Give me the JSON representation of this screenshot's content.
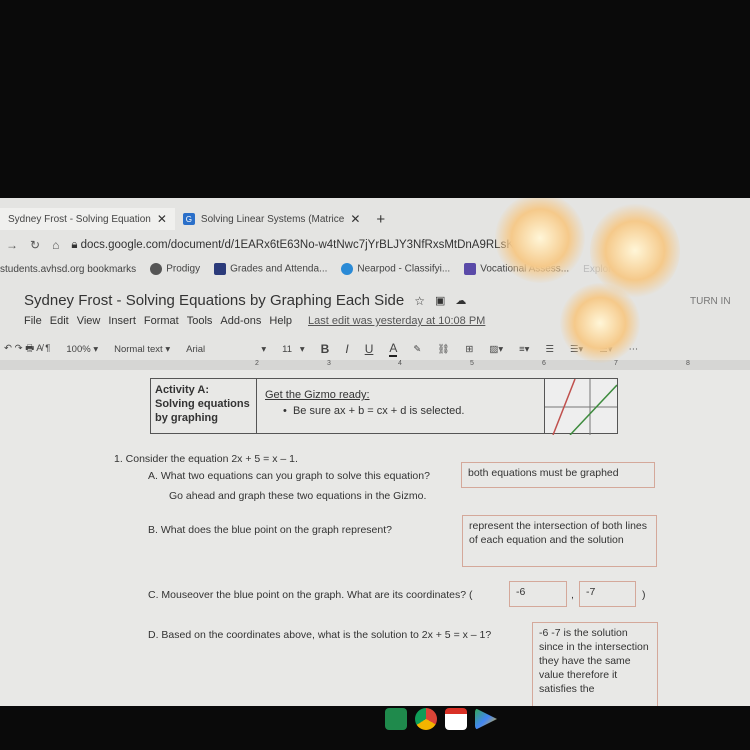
{
  "browser": {
    "tabs": [
      {
        "label": "Sydney Frost - Solving Equation",
        "active": true
      },
      {
        "label": "Solving Linear Systems (Matrice",
        "active": false
      }
    ],
    "new_tab": "+",
    "url": "docs.google.com/document/d/1EARx6tE63No-w4tNwc7jYrBLJY3NfRxsMtDnA9RLsKU/edit",
    "bookmarks": [
      "students.avhsd.org bookmarks",
      "Prodigy",
      "Grades and Attenda...",
      "Nearpod - Classifyi...",
      "Vocational Assess...",
      "ExploreLearning"
    ]
  },
  "doc": {
    "title": "Sydney Frost - Solving Equations by Graphing Each Side",
    "turn_in": "TURN IN",
    "menu": [
      "File",
      "Edit",
      "View",
      "Insert",
      "Format",
      "Tools",
      "Add-ons",
      "Help"
    ],
    "last_edit": "Last edit was yesterday at 10:08 PM",
    "toolbar": {
      "zoom": "100%",
      "style": "Normal text",
      "font": "Arial",
      "size": "11",
      "bold": "B",
      "italic": "I",
      "underline": "U",
      "color": "A"
    },
    "ruler": [
      "1",
      "2",
      "3",
      "4",
      "5",
      "6",
      "7",
      "8"
    ]
  },
  "content": {
    "activity_label": "Activity A:",
    "activity_name": "Solving equations by graphing",
    "gizmo_heading": "Get the Gizmo ready:",
    "gizmo_bullet": "Be sure ax + b = cx + d is selected.",
    "q1": "1.  Consider the equation 2x + 5 = x – 1.",
    "qa": "A.  What two equations can you graph to solve this equation?",
    "qa_answer": "both equations must be graphed",
    "qa_note": "Go ahead and graph these two equations in the Gizmo.",
    "qb": "B.  What does the blue point on the graph represent?",
    "qb_answer": "represent the intersection of both lines of each equation and the solution",
    "qc": "C.  Mouseover the blue point on the graph. What are its coordinates?   (",
    "qc_x": "-6",
    "qc_comma": ",",
    "qc_y": "-7",
    "qc_close": ")",
    "qd": "D.  Based on the coordinates above, what is the solution to 2x + 5 = x – 1?",
    "qd_answer": "-6 -7 is the solution since in the intersection they have the same value therefore it satisfies the"
  }
}
